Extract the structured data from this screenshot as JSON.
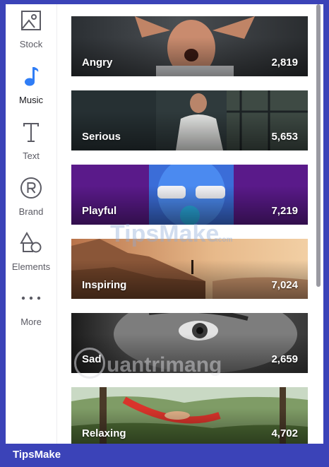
{
  "sidebar": {
    "items": [
      {
        "label": "Stock",
        "icon": "image-icon"
      },
      {
        "label": "Music",
        "icon": "music-note-icon",
        "active": true
      },
      {
        "label": "Text",
        "icon": "text-t-icon"
      },
      {
        "label": "Brand",
        "icon": "registered-r-icon"
      },
      {
        "label": "Elements",
        "icon": "shapes-icon"
      },
      {
        "label": "More",
        "icon": "more-dots-icon"
      }
    ],
    "accent_color": "#2f7df6"
  },
  "moods": [
    {
      "name": "Angry",
      "count": "2,819"
    },
    {
      "name": "Serious",
      "count": "5,653"
    },
    {
      "name": "Playful",
      "count": "7,219"
    },
    {
      "name": "Inspiring",
      "count": "7,024"
    },
    {
      "name": "Sad",
      "count": "2,659"
    },
    {
      "name": "Relaxing",
      "count": "4,702"
    }
  ],
  "watermarks": {
    "tipsmake": "TipsMake",
    "tipsmake_suffix": ".com",
    "quantrimang": "uantrimang"
  },
  "footer": {
    "brand": "TipsMake"
  },
  "frame_color": "#3b43b8"
}
